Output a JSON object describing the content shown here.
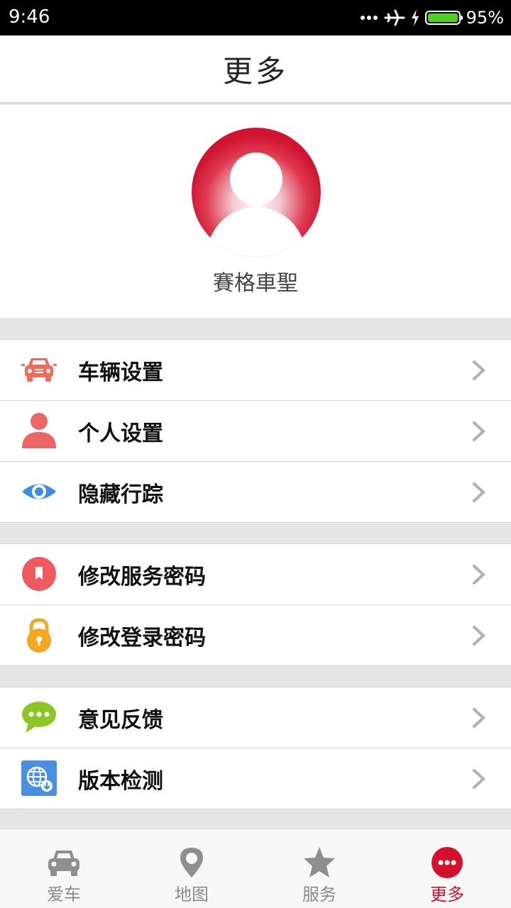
{
  "status_bar": {
    "time": "9:46",
    "battery_percent": "95%"
  },
  "header": {
    "title": "更多"
  },
  "profile": {
    "username": "賽格車聖"
  },
  "groups": [
    {
      "items": [
        {
          "label": "车辆设置",
          "icon": "car-icon"
        },
        {
          "label": "个人设置",
          "icon": "person-icon"
        },
        {
          "label": "隐藏行踪",
          "icon": "eye-icon"
        }
      ]
    },
    {
      "items": [
        {
          "label": "修改服务密码",
          "icon": "bookmark-icon"
        },
        {
          "label": "修改登录密码",
          "icon": "lock-icon"
        }
      ]
    },
    {
      "items": [
        {
          "label": "意见反馈",
          "icon": "chat-bubble-icon"
        },
        {
          "label": "版本检测",
          "icon": "globe-download-icon"
        }
      ]
    }
  ],
  "tabs": [
    {
      "label": "爱车",
      "icon": "car-icon",
      "active": false
    },
    {
      "label": "地图",
      "icon": "map-pin-icon",
      "active": false
    },
    {
      "label": "服务",
      "icon": "star-icon",
      "active": false
    },
    {
      "label": "更多",
      "icon": "more-icon",
      "active": true
    }
  ],
  "colors": {
    "accent": "#d5102c",
    "tab_inactive": "#8a8a8a"
  }
}
